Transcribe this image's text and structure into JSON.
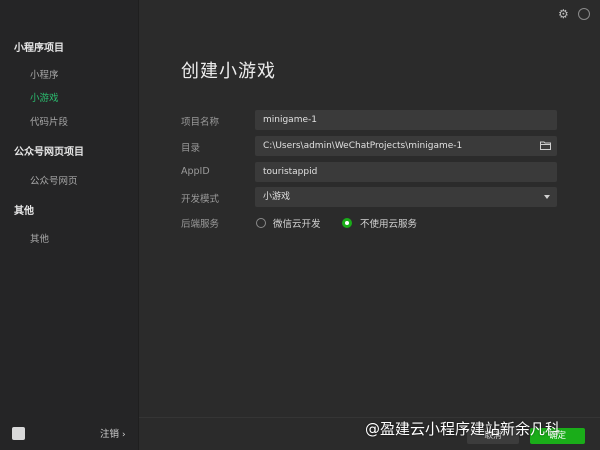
{
  "sidebar": {
    "groups": [
      {
        "title": "小程序项目",
        "items": [
          "小程序",
          "小游戏",
          "代码片段"
        ]
      },
      {
        "title": "公众号网页项目",
        "items": [
          "公众号网页"
        ]
      },
      {
        "title": "其他",
        "items": [
          "其他"
        ]
      }
    ],
    "active_item": "小游戏",
    "logout_label": "注销",
    "logout_chevron": "›"
  },
  "header": {
    "settings_icon": "gear-icon"
  },
  "main": {
    "title": "创建小游戏",
    "form": {
      "project_name": {
        "label": "项目名称",
        "value": "minigame-1"
      },
      "directory": {
        "label": "目录",
        "value": "C:\\Users\\admin\\WeChatProjects\\minigame-1",
        "icon": "folder-icon"
      },
      "appid": {
        "label": "AppID",
        "value": "touristappid"
      },
      "dev_mode": {
        "label": "开发模式",
        "value": "小游戏"
      },
      "backend": {
        "label": "后端服务",
        "options": [
          {
            "label": "微信云开发",
            "selected": false
          },
          {
            "label": "不使用云服务",
            "selected": true
          }
        ]
      }
    }
  },
  "footer": {
    "cancel_label": "取消",
    "confirm_label": "确定"
  },
  "watermark": "@盈建云小程序建站新余凡科",
  "colors": {
    "accent": "#1aad19",
    "active_nav": "#2bbd6f",
    "background": "#2b2b2b",
    "sidebar": "#252526"
  }
}
